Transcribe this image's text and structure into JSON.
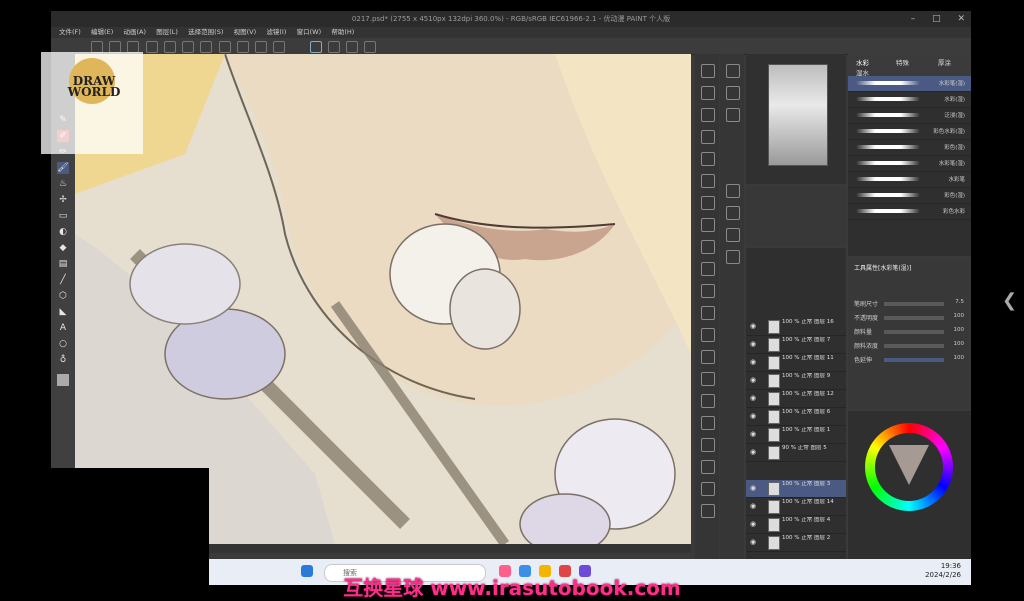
{
  "window": {
    "title": "0217.psd* (2755 x 4510px 132dpi 360.0%) - RGB/sRGB IEC61966-2.1 - 优动漫 PAINT 个人版",
    "controls": [
      "–",
      "□",
      "✕"
    ]
  },
  "menu": [
    "文件(F)",
    "编辑(E)",
    "动画(A)",
    "图层(L)",
    "选择范围(S)",
    "视图(V)",
    "滤镜(I)",
    "窗口(W)",
    "帮助(H)"
  ],
  "logo": {
    "text": "DRAW WORLD"
  },
  "brush_panel": {
    "tabs": [
      "水彩",
      "特殊",
      "厚涂"
    ],
    "subtab": "湿水",
    "brushes": [
      "水彩笔(湿)",
      "水彩(湿)",
      "泛浸(湿)",
      "彩色水彩(湿)",
      "彩色(湿)",
      "水彩笔(湿)",
      "水彩笔",
      "彩色(湿)",
      "彩色水彩"
    ]
  },
  "layers": [
    {
      "name": "100 % 正常 图层 16"
    },
    {
      "name": "100 % 正常 图层 7"
    },
    {
      "name": "100 % 正常 图层 11"
    },
    {
      "name": "100 % 正常 图层 9"
    },
    {
      "name": "100 % 正常 图层 12"
    },
    {
      "name": "100 % 正常 图层 6"
    },
    {
      "name": "100 % 正常 图层 1"
    },
    {
      "name": "100 % 正常 图层 3"
    },
    {
      "name": "100 % 正常 图层 14"
    },
    {
      "name": "100 % 正常 图层 4"
    },
    {
      "name": "100 % 正常 图层 2"
    },
    {
      "name": "90 % 正常 图层 5"
    }
  ],
  "tool_property": {
    "title": "工具属性[水彩笔(湿)]",
    "rows": [
      {
        "label": "笔刷尺寸",
        "value": "7.5"
      },
      {
        "label": "不透明度",
        "value": "100"
      },
      {
        "label": "颜料量",
        "value": "100"
      },
      {
        "label": "颜料浓度",
        "value": "100"
      },
      {
        "label": "色延伸",
        "value": "100"
      }
    ]
  },
  "taskbar": {
    "search_placeholder": "搜索",
    "time": "19:36",
    "date": "2024/2/26"
  },
  "watermark": "互换星球 www.irasutobook.com",
  "colors": {
    "accent": "#4a5a82",
    "watermark": "#ff2d8a"
  }
}
